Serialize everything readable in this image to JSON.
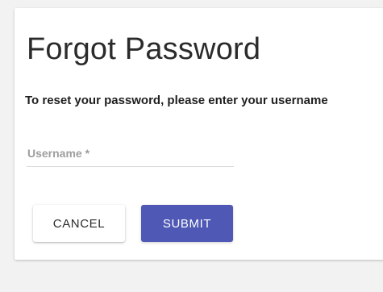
{
  "dialog": {
    "title": "Forgot Password",
    "instructions": "To reset your password, please enter your username"
  },
  "form": {
    "username": {
      "label": "Username *",
      "value": ""
    }
  },
  "actions": {
    "cancel_label": "CANCEL",
    "submit_label": "SUBMIT"
  },
  "colors": {
    "primary": "#4f59b5",
    "background": "#f2f2f2",
    "card": "#ffffff"
  }
}
